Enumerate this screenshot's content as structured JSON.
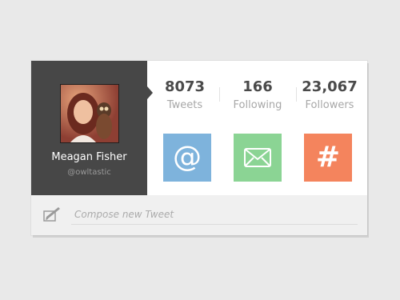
{
  "profile": {
    "name": "Meagan Fisher",
    "handle": "@owltastic"
  },
  "stats": [
    {
      "value": "8073",
      "label": "Tweets"
    },
    {
      "value": "166",
      "label": "Following"
    },
    {
      "value": "23,067",
      "label": "Followers"
    }
  ],
  "actions": [
    {
      "icon": "at-sign-icon",
      "glyph": "@",
      "color": "#7eb3dc"
    },
    {
      "icon": "envelope-icon",
      "color": "#8bd494"
    },
    {
      "icon": "hashtag-icon",
      "glyph": "#",
      "color": "#f4845d"
    }
  ],
  "compose": {
    "placeholder": "Compose new Tweet"
  },
  "colors": {
    "profile_bg": "#474747",
    "page_bg": "#e9e9e9"
  }
}
